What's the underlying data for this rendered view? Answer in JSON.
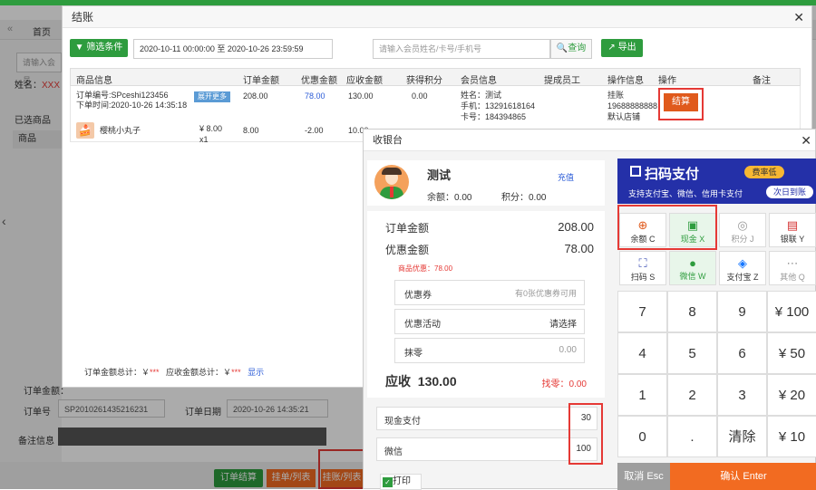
{
  "background": {
    "home_tab": "首页",
    "search_placeholder": "请输入会员",
    "name_label": "姓名：",
    "name_value": "XXX",
    "selected_goods": "已选商品",
    "goods_header": "商品",
    "order_amount_label": "订单金额：",
    "order_no_label": "订单号",
    "order_no_value": "SP2010261435216231",
    "order_date_label": "订单日期",
    "order_date_value": "2020-10-26 14:35:21",
    "remark_label": "备注信息",
    "btn_checkout_list": "订单结算",
    "btn_hang": "挂单/列表",
    "btn_hang_list": "挂账/列表"
  },
  "checkout_modal": {
    "title": "结账",
    "filter_button": "筛选条件",
    "date_range": "2020-10-11 00:00:00 至 2020-10-26 23:59:59",
    "member_search_placeholder": "请输入会员姓名/卡号/手机号",
    "search_button": "查询",
    "export_button": "导出",
    "columns": [
      "商品信息",
      "订单金额",
      "优惠金额",
      "应收金额",
      "获得积分",
      "会员信息",
      "提成员工",
      "操作信息",
      "操作",
      "备注"
    ],
    "row": {
      "order_no": "订单编号:SPceshi123456",
      "order_time": "下单时间:2020-10-26 14:35:18",
      "expand": "展开更多",
      "order_amount": "208.00",
      "discount": "78.00",
      "receivable": "130.00",
      "points": "0.00",
      "member_name": "姓名：测试",
      "member_phone": "手机：13291618164",
      "member_card": "卡号：184394865",
      "op_status": "挂账",
      "op_code": "19688888888",
      "op_store": "默认店铺",
      "settle_button": "结算"
    },
    "item": {
      "name": "樱桃小丸子",
      "price": "¥ 8.00",
      "qty": "x1",
      "amount": "8.00",
      "discount": "-2.00",
      "receivable": "10.00"
    },
    "footer_order_total": "订单金额总计：￥",
    "footer_receivable_total": "应收金额总计：￥",
    "stars": "***",
    "footer_show": "显示"
  },
  "cashier": {
    "title": "收银台",
    "member_name": "测试",
    "recharge": "充值",
    "balance": "余额：0.00",
    "points": "积分：0.00",
    "order_amount_label": "订单金额",
    "order_amount": "208.00",
    "discount_label": "优惠金额",
    "discount": "78.00",
    "goods_discount": "商品优惠：78.00",
    "coupon_label": "优惠券",
    "coupon_hint": "有0张优惠券可用",
    "promo_label": "优惠活动",
    "promo_select": "请选择",
    "rounding_label": "抹零",
    "rounding_value": "0.00",
    "receivable_label": "应收",
    "receivable_value": "130.00",
    "change_label": "找零：0.00",
    "cash_pay_label": "现金支付",
    "cash_pay_value": "30",
    "wechat_label": "微信",
    "wechat_value": "100",
    "print_label": "打印",
    "banner_title": "扫码支付",
    "banner_badge": "费率低",
    "banner_sub": "支持支付宝、微信、信用卡支付",
    "banner_badge2": "次日到账",
    "pay_methods": [
      {
        "label": "余额 C",
        "icon": "balance-icon"
      },
      {
        "label": "现金 X",
        "icon": "cash-icon"
      },
      {
        "label": "积分 J",
        "icon": "points-icon"
      },
      {
        "label": "银联 Y",
        "icon": "unionpay-icon"
      },
      {
        "label": "扫码 S",
        "icon": "scan-icon"
      },
      {
        "label": "微信 W",
        "icon": "wechat-icon"
      },
      {
        "label": "支付宝 Z",
        "icon": "alipay-icon"
      },
      {
        "label": "其他 Q",
        "icon": "other-icon"
      }
    ],
    "keypad": [
      "7",
      "8",
      "9",
      "¥ 100",
      "4",
      "5",
      "6",
      "¥ 50",
      "1",
      "2",
      "3",
      "¥ 20",
      "0",
      ".",
      "清除",
      "¥ 10"
    ],
    "cancel": "取消 Esc",
    "confirm": "确认 Enter"
  },
  "colors": {
    "brand_green": "#2e9c3e",
    "confirm_orange": "#f26b21",
    "highlight_red": "#e53935",
    "accent_blue": "#2a5bd7"
  }
}
